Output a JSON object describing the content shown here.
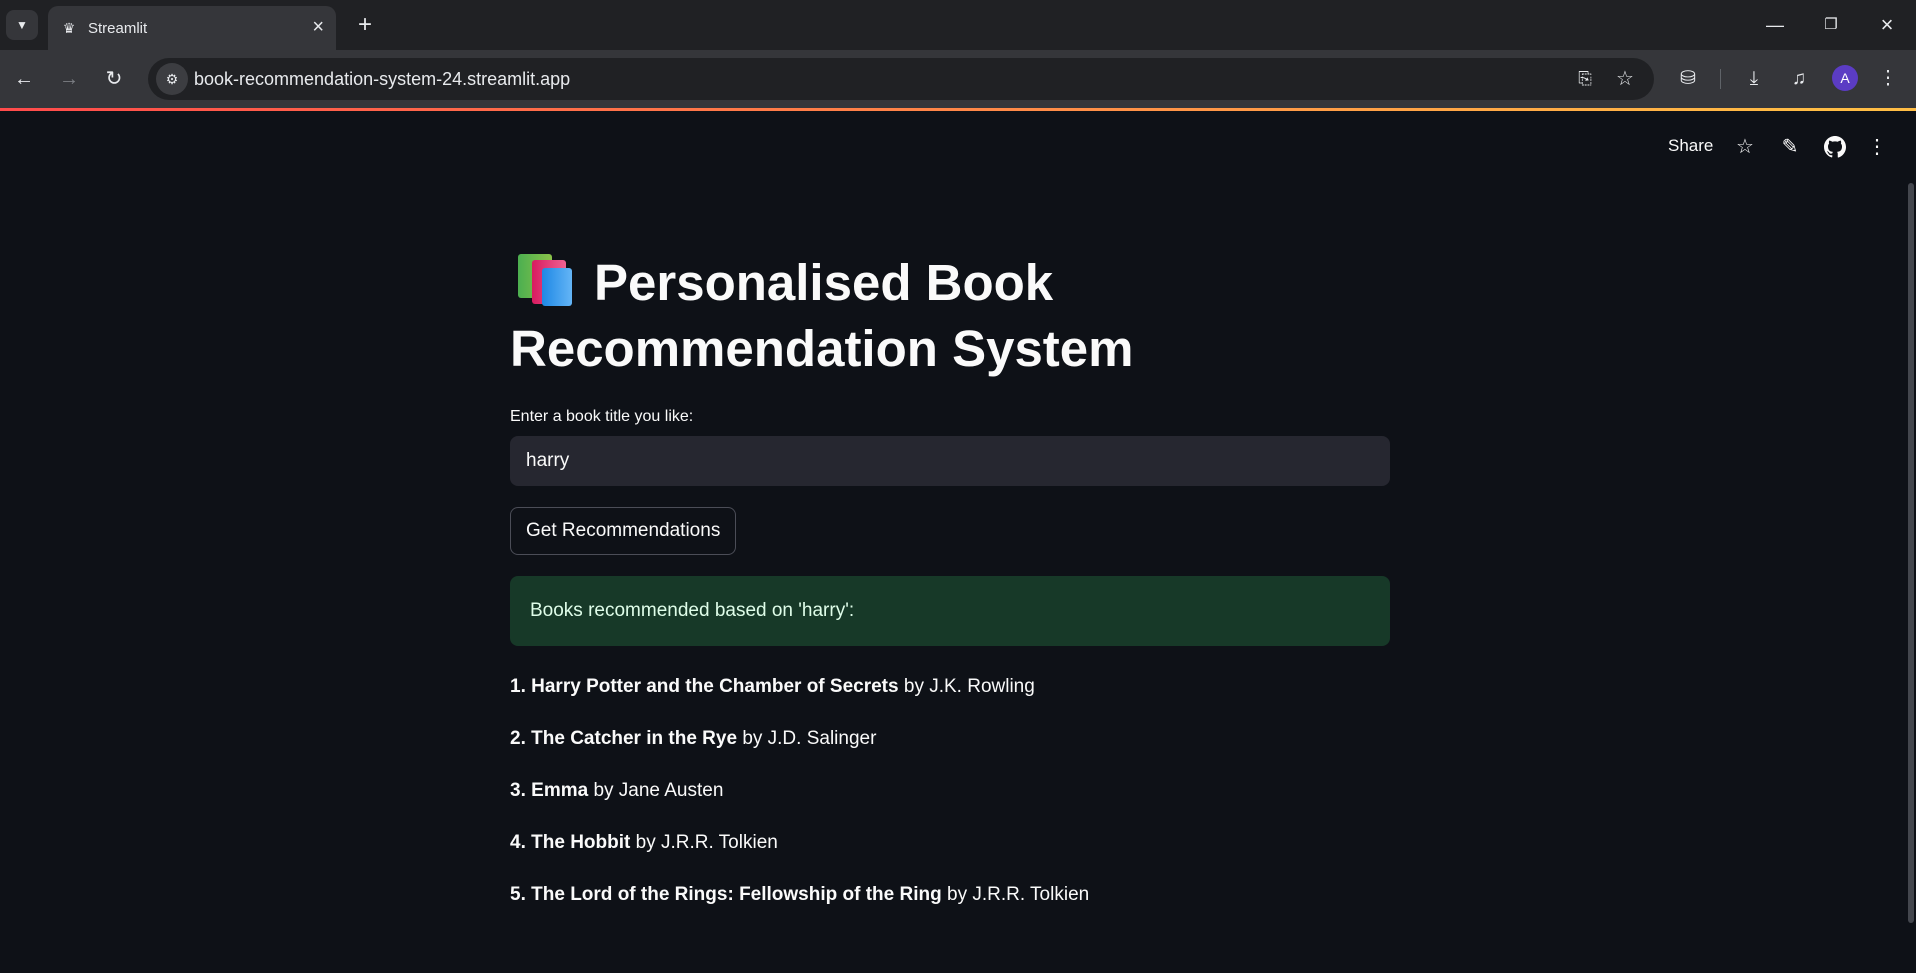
{
  "browser": {
    "tab_title": "Streamlit",
    "url": "book-recommendation-system-24.streamlit.app",
    "avatar_letter": "A"
  },
  "header": {
    "share_label": "Share"
  },
  "app": {
    "title_line1": "Personalised Book",
    "title_line2": "Recommendation System",
    "input_label": "Enter a book title you like:",
    "input_value": "harry",
    "button_label": "Get Recommendations",
    "success_message": "Books recommended based on 'harry':",
    "recommendations": [
      {
        "num": "1.",
        "title": "Harry Potter and the Chamber of Secrets",
        "by": "by J.K. Rowling"
      },
      {
        "num": "2.",
        "title": "The Catcher in the Rye",
        "by": "by J.D. Salinger"
      },
      {
        "num": "3.",
        "title": "Emma",
        "by": "by Jane Austen"
      },
      {
        "num": "4.",
        "title": "The Hobbit",
        "by": "by J.R.R. Tolkien"
      },
      {
        "num": "5.",
        "title": "The Lord of the Rings: Fellowship of the Ring",
        "by": "by J.R.R. Tolkien"
      }
    ]
  },
  "colors": {
    "background": "#0e1117",
    "input_background": "#262730",
    "success_background": "#173928",
    "accent_gradient_start": "#ff4b4b",
    "accent_gradient_end": "#ffbd45"
  }
}
